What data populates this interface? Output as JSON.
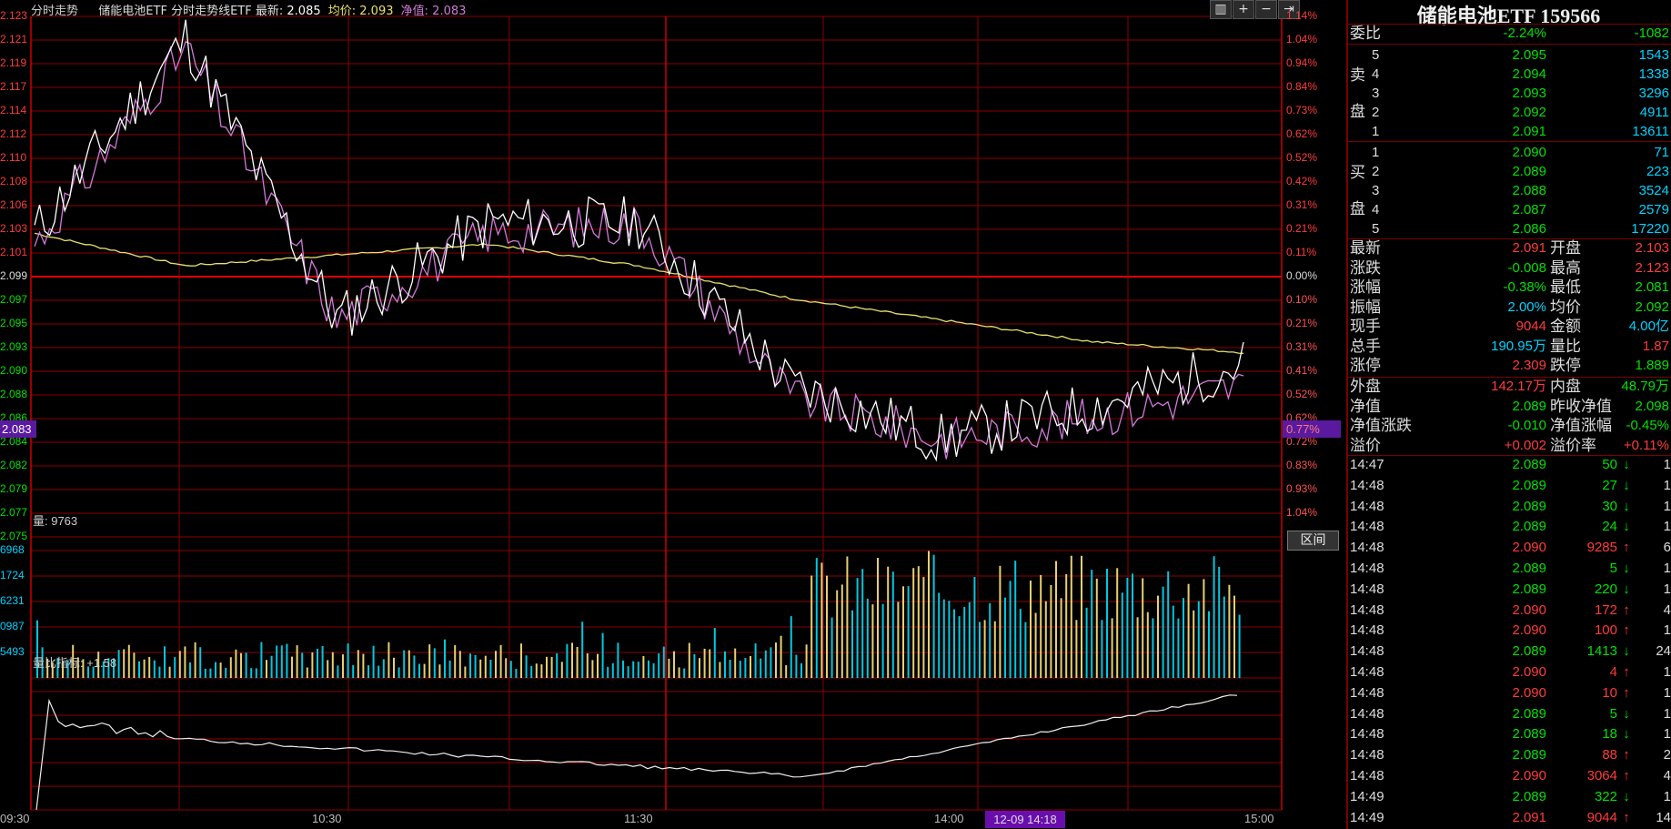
{
  "header": {
    "mode_label": "分时走势",
    "name": "储能电池ETF",
    "chart_label": "分时走势线ETF",
    "latest_label": "最新:",
    "latest": "2.085",
    "avg_label": "均价:",
    "avg": "2.093",
    "nav_label": "净值:",
    "nav": "2.083"
  },
  "toolbar": {
    "b1": "▥",
    "b2": "+",
    "b3": "−",
    "b4": "⇥"
  },
  "price_axis_left": [
    "2.123",
    "2.121",
    "2.119",
    "2.117",
    "2.114",
    "2.112",
    "2.110",
    "2.108",
    "2.106",
    "2.103",
    "2.101",
    "2.099",
    "2.097",
    "2.095",
    "2.093",
    "2.090",
    "2.088",
    "2.086",
    "2.084",
    "2.082",
    "2.079",
    "2.077",
    "2.075"
  ],
  "price_axis_right": [
    "1.14%",
    "1.04%",
    "0.94%",
    "0.84%",
    "0.73%",
    "0.62%",
    "0.52%",
    "0.42%",
    "0.31%",
    "0.21%",
    "0.11%",
    "0.00%",
    "0.10%",
    "0.21%",
    "0.31%",
    "0.41%",
    "0.52%",
    "0.62%",
    "0.72%",
    "0.83%",
    "0.93%",
    "1.04%",
    "1.14%"
  ],
  "nav_marker": {
    "left": "2.083",
    "right": "0.77%"
  },
  "volume": {
    "label": "量: 9763",
    "axis": [
      "6968",
      "1724",
      "6231",
      "0987",
      "5493"
    ],
    "button": "区间"
  },
  "indicator": {
    "label": "量比指标: +1.58"
  },
  "time_axis": [
    "09:30",
    "10:30",
    "11:30",
    "14:00",
    "15:00"
  ],
  "cursor_time": "12-09 14:18",
  "colors": {
    "bg": "#000000",
    "grid": "#8b0000",
    "price_line": "#ffffff",
    "avg_line": "#e8e06a",
    "nav_line": "#d07ad8",
    "up": "#ff3b3b",
    "down": "#00e000",
    "cyan": "#00d2ff",
    "accent_purple": "#6a0dad"
  },
  "panel": {
    "title": "储能电池ETF 159566",
    "weibi": {
      "label": "委比",
      "pct": "-2.24%",
      "diff": "-1082"
    },
    "sell_label": [
      "卖",
      "盘"
    ],
    "buy_label": [
      "买",
      "盘"
    ],
    "sell": [
      {
        "lvl": "5",
        "price": "2.095",
        "vol": "1543"
      },
      {
        "lvl": "4",
        "price": "2.094",
        "vol": "1338"
      },
      {
        "lvl": "3",
        "price": "2.093",
        "vol": "3296"
      },
      {
        "lvl": "2",
        "price": "2.092",
        "vol": "4911"
      },
      {
        "lvl": "1",
        "price": "2.091",
        "vol": "13611"
      }
    ],
    "buy": [
      {
        "lvl": "1",
        "price": "2.090",
        "vol": "71"
      },
      {
        "lvl": "2",
        "price": "2.089",
        "vol": "223"
      },
      {
        "lvl": "3",
        "price": "2.088",
        "vol": "3524"
      },
      {
        "lvl": "4",
        "price": "2.087",
        "vol": "2579"
      },
      {
        "lvl": "5",
        "price": "2.086",
        "vol": "17220"
      }
    ],
    "quote": [
      {
        "l1": "最新",
        "v1": "2.091",
        "c1": "up",
        "l2": "开盘",
        "v2": "2.103",
        "c2": "up"
      },
      {
        "l1": "涨跌",
        "v1": "-0.008",
        "c1": "down",
        "l2": "最高",
        "v2": "2.123",
        "c2": "up"
      },
      {
        "l1": "涨幅",
        "v1": "-0.38%",
        "c1": "down",
        "l2": "最低",
        "v2": "2.081",
        "c2": "down"
      },
      {
        "l1": "振幅",
        "v1": "2.00%",
        "c1": "cyan",
        "l2": "均价",
        "v2": "2.092",
        "c2": "down"
      },
      {
        "l1": "现手",
        "v1": "9044",
        "c1": "up",
        "l2": "金额",
        "v2": "4.00亿",
        "c2": "cyan"
      },
      {
        "l1": "总手",
        "v1": "190.95万",
        "c1": "cyan",
        "l2": "量比",
        "v2": "1.87",
        "c2": "up"
      },
      {
        "l1": "涨停",
        "v1": "2.309",
        "c1": "up",
        "l2": "跌停",
        "v2": "1.889",
        "c2": "down"
      }
    ],
    "quote2": [
      {
        "l1": "外盘",
        "v1": "142.17万",
        "c1": "up",
        "l2": "内盘",
        "v2": "48.79万",
        "c2": "down"
      },
      {
        "l1": "净值",
        "v1": "2.089",
        "c1": "down",
        "l2": "昨收净值",
        "v2": "2.098",
        "c2": "down"
      },
      {
        "l1": "净值涨跌",
        "v1": "-0.010",
        "c1": "down",
        "l2": "净值涨幅",
        "v2": "-0.45%",
        "c2": "down"
      },
      {
        "l1": "溢价",
        "v1": "+0.002",
        "c1": "up",
        "l2": "溢价率",
        "v2": "+0.11%",
        "c2": "up"
      }
    ],
    "ticks": [
      {
        "time": "14:47",
        "price": "2.089",
        "vol": "50",
        "dir": "down",
        "n": "1"
      },
      {
        "time": "14:48",
        "price": "2.089",
        "vol": "27",
        "dir": "down",
        "n": "1"
      },
      {
        "time": "14:48",
        "price": "2.089",
        "vol": "30",
        "dir": "down",
        "n": "1"
      },
      {
        "time": "14:48",
        "price": "2.089",
        "vol": "24",
        "dir": "down",
        "n": "1"
      },
      {
        "time": "14:48",
        "price": "2.090",
        "vol": "9285",
        "dir": "up",
        "n": "6"
      },
      {
        "time": "14:48",
        "price": "2.089",
        "vol": "5",
        "dir": "down",
        "n": "1"
      },
      {
        "time": "14:48",
        "price": "2.089",
        "vol": "220",
        "dir": "down",
        "n": "1"
      },
      {
        "time": "14:48",
        "price": "2.090",
        "vol": "172",
        "dir": "up",
        "n": "4"
      },
      {
        "time": "14:48",
        "price": "2.090",
        "vol": "100",
        "dir": "up",
        "n": "1"
      },
      {
        "time": "14:48",
        "price": "2.089",
        "vol": "1413",
        "dir": "down",
        "n": "24"
      },
      {
        "time": "14:48",
        "price": "2.090",
        "vol": "4",
        "dir": "up",
        "n": "1"
      },
      {
        "time": "14:48",
        "price": "2.090",
        "vol": "10",
        "dir": "up",
        "n": "1"
      },
      {
        "time": "14:48",
        "price": "2.089",
        "vol": "5",
        "dir": "down",
        "n": "1"
      },
      {
        "time": "14:48",
        "price": "2.089",
        "vol": "18",
        "dir": "down",
        "n": "1"
      },
      {
        "time": "14:48",
        "price": "2.089",
        "vol": "88",
        "dir": "up",
        "n": "2"
      },
      {
        "time": "14:48",
        "price": "2.090",
        "vol": "3064",
        "dir": "up",
        "n": "4"
      },
      {
        "time": "14:49",
        "price": "2.089",
        "vol": "322",
        "dir": "down",
        "n": "1"
      },
      {
        "time": "14:49",
        "price": "2.091",
        "vol": "9044",
        "dir": "up",
        "n": "14"
      }
    ]
  },
  "chart_data": {
    "type": "line",
    "title": "分时走势线ETF",
    "ylim": [
      2.075,
      2.123
    ],
    "prev_close": 2.099,
    "x": [
      "09:30",
      "10:00",
      "10:30",
      "11:00",
      "11:30",
      "13:30",
      "14:00",
      "14:30",
      "14:49"
    ],
    "series": [
      {
        "name": "最新",
        "values": [
          2.103,
          2.121,
          2.095,
          2.104,
          2.104,
          2.089,
          2.084,
          2.087,
          2.091
        ]
      },
      {
        "name": "均价",
        "values": [
          2.103,
          2.1,
          2.101,
          2.102,
          2.1,
          2.097,
          2.095,
          2.093,
          2.092
        ]
      },
      {
        "name": "净值",
        "values": [
          2.102,
          2.12,
          2.095,
          2.103,
          2.104,
          2.088,
          2.084,
          2.086,
          2.089
        ]
      }
    ],
    "volume_label": "量: 9763",
    "indicator_label": "量比指标: +1.58"
  }
}
